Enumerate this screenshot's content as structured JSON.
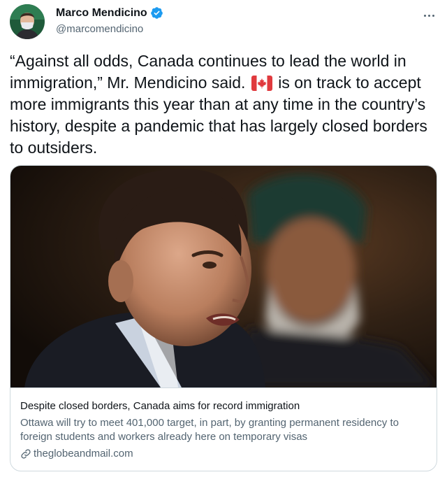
{
  "author": {
    "display_name": "Marco Mendicino",
    "handle": "@marcomendicino",
    "verified": true
  },
  "tweet": {
    "text_before_flag": "“Against all odds, Canada continues to lead the world in immigration,” Mr. Mendicino said.",
    "flag_icon": "canada-flag-emoji",
    "text_after_flag": "is on track to accept more immigrants this year than at any time in the country’s history, despite a pandemic that has largely closed borders to outsiders."
  },
  "link_card": {
    "title": "Despite closed borders, Canada aims for record immigration",
    "description": "Ottawa will try to meet 401,000 target, in part, by granting permanent residency to foreign students and workers already here on temporary visas",
    "domain": "theglobeandmail.com",
    "domain_icon": "link-icon"
  },
  "colors": {
    "verified_badge": "#1d9bf0",
    "secondary_text": "#536471",
    "border": "#cfd9de"
  }
}
